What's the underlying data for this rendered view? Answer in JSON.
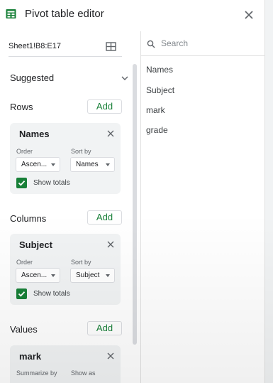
{
  "header": {
    "title": "Pivot table editor",
    "title_icon": "sheets-table-icon",
    "close_icon": "close-icon"
  },
  "data_range": {
    "value": "Sheet1!B8:E17",
    "icon": "select-range-grid-icon"
  },
  "suggested": {
    "label": "Suggested",
    "icon": "chevron-down-icon"
  },
  "rows": {
    "label": "Rows",
    "add_label": "Add",
    "card": {
      "title": "Names",
      "order_label": "Order",
      "order_value": "Ascen...",
      "sortby_label": "Sort by",
      "sortby_value": "Names",
      "show_totals_label": "Show totals",
      "show_totals_checked": true
    }
  },
  "columns": {
    "label": "Columns",
    "add_label": "Add",
    "card": {
      "title": "Subject",
      "order_label": "Order",
      "order_value": "Ascen...",
      "sortby_label": "Sort by",
      "sortby_value": "Subject",
      "show_totals_label": "Show totals",
      "show_totals_checked": true
    }
  },
  "values": {
    "label": "Values",
    "add_label": "Add",
    "card": {
      "title": "mark",
      "summarize_label": "Summarize by",
      "showas_label": "Show as"
    }
  },
  "field_list": {
    "search_placeholder": "Search",
    "fields": [
      "Names",
      "Subject",
      "mark",
      "grade"
    ]
  },
  "colors": {
    "accent_green": "#188038",
    "card_bg": "#f1f3f4",
    "border": "#dadce0"
  }
}
